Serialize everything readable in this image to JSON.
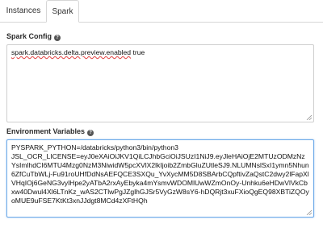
{
  "tabs": [
    {
      "label": "Instances",
      "active": false
    },
    {
      "label": "Spark",
      "active": true
    }
  ],
  "spark_config": {
    "label": "Spark Config",
    "value_key": "spark.databricks.delta.preview.enabled",
    "value_rest": " true"
  },
  "env_vars": {
    "label": "Environment Variables",
    "lines": [
      "PYSPARK_PYTHON=/databricks/python3/bin/python3",
      "JSL_OCR_LICENSE=eyJ0eXAiOiJKV1QiLCJhbGciOiJSUzI1NiJ9.eyJleHAiOjE2MTUzODMzNzYsImlhdCI6MTU4Mzg0NzM3NiwidW5pcXVlX2lkIjoib2ZmbGluZUtleSJ9.NLUMNslSxI1ymn5Nhun6ZfCuTbWLj-Fu91roUHfDdNsAEFQCE3SXQu_YvXycMM5D8SBArbCQpftivZaQstC2dwy2lFapXlVHqIOj6GeNG3vylHpe2yATbA2rxAyEbyka4mYsmvWDOMlUwWZmOnOy-Unhku6eHDwVlVkCbxw40Dwul4Xl6LTnKz_wAS2CTlwPgJZglhGJSr5VyGzW8sY6-hDQRjt3xuFXioQgEQ98XBTiZQOyoMUE9uFSE7KtKt3xnJJdgt8MCd4zXFtHQh"
    ]
  },
  "colors": {
    "accent": "#6ca9e8",
    "border": "#cfcfcf"
  },
  "icons": {
    "help": "help-circle-icon"
  }
}
